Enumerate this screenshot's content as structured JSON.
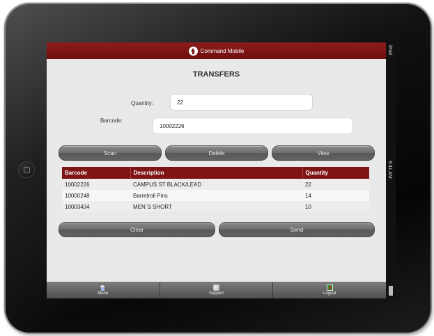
{
  "device": {
    "carrier": "iPad",
    "time": "9:41 AM"
  },
  "header": {
    "app_title": "Command Mobile"
  },
  "page": {
    "title": "TRANSFERS"
  },
  "form": {
    "quantity_label": "Quantity:",
    "quantity_value": "22",
    "barcode_label": "Barcode:",
    "barcode_value": "10002226"
  },
  "actions": {
    "scan": "Scan",
    "delete": "Delete",
    "view": "View",
    "clear": "Clear",
    "send": "Send"
  },
  "table": {
    "columns": [
      "Barcode",
      "Description",
      "Quantity"
    ],
    "rows": [
      [
        "10002226",
        "CAMPUS ST BLACK/LEAD",
        "22"
      ],
      [
        "10000248",
        "Barrelroll Pins",
        "14"
      ],
      [
        "10003434",
        "MEN`S SHORT",
        "10"
      ]
    ]
  },
  "tabbar": {
    "menu": "Menu",
    "support": "Support",
    "logout": "Logout"
  },
  "colors": {
    "brand": "#7e1414",
    "button": "#6c6c6c",
    "background": "#e9e9e9"
  }
}
